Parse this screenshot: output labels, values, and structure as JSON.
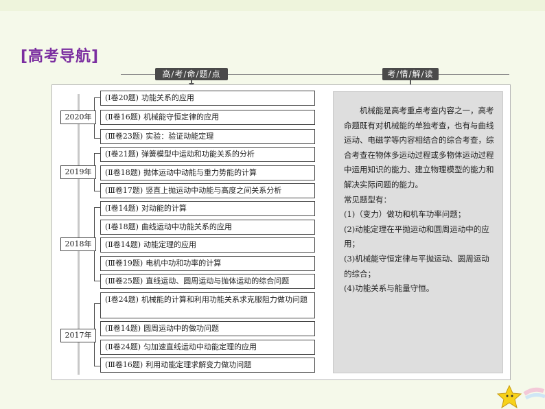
{
  "title": "[高考导航]",
  "headers": {
    "left": "高/考/命/题/点",
    "right": "考/情/解/读"
  },
  "groups": [
    {
      "year": "2020年",
      "items": [
        {
          "source": "(Ⅰ卷20题)",
          "text": "功能关系的应用"
        },
        {
          "source": "(Ⅱ卷16题)",
          "text": "机械能守恒定律的应用"
        },
        {
          "source": "(Ⅲ卷23题)",
          "text": "实验：验证动能定理"
        }
      ]
    },
    {
      "year": "2019年",
      "items": [
        {
          "source": "(Ⅰ卷21题)",
          "text": "弹簧模型中运动和功能关系的分析"
        },
        {
          "source": "(Ⅱ卷18题)",
          "text": "抛体运动中动能与重力势能的计算"
        },
        {
          "source": "(Ⅲ卷17题)",
          "text": "竖直上抛运动中动能与高度之间关系分析"
        }
      ]
    },
    {
      "year": "2018年",
      "items": [
        {
          "source": "(Ⅰ卷14题)",
          "text": "对动能的计算"
        },
        {
          "source": "(Ⅰ卷18题)",
          "text": "曲线运动中功能关系的应用"
        },
        {
          "source": "(Ⅱ卷14题)",
          "text": "动能定理的应用"
        },
        {
          "source": "(Ⅲ卷19题)",
          "text": "电机中功和功率的计算"
        },
        {
          "source": "(Ⅲ卷25题)",
          "text": "直线运动、圆周运动与抛体运动的综合问题"
        }
      ]
    },
    {
      "year": "2017年",
      "items": [
        {
          "source": "(Ⅰ卷24题)",
          "text": "机械能的计算和利用功能关系求克服阻力做功问题"
        },
        {
          "source": "(Ⅱ卷14题)",
          "text": "圆周运动中的做功问题"
        },
        {
          "source": "(Ⅱ卷24题)",
          "text": "匀加速直线运动中动能定理的应用"
        },
        {
          "source": "(Ⅲ卷16题)",
          "text": "利用动能定理求解变力做功问题"
        }
      ]
    }
  ],
  "analysis": {
    "intro": "机械能是高考重点考查内容之一，高考命题既有对机械能的单独考查，也有与曲线运动、电磁学等内容相结合的综合考查，综合考查在物体多运动过程或多物体运动过程中运用知识的能力、建立物理模型的能力和解决实际问题的能力。",
    "types_heading": "常见题型有：",
    "types": [
      "(1)（变力）做功和机车功率问题；",
      "(2)动能定理在平抛运动和圆周运动中的应用；",
      "(3)机械能守恒定律与平抛运动、圆周运动的综合；",
      "(4)功能关系与能量守恒。"
    ]
  },
  "colors": {
    "background": "#f5f9ea",
    "title": "#7b2ea0",
    "header_label_bg": "#4a4a4a",
    "panel_bg": "#dedede",
    "star": "#f7d21a"
  },
  "icons": [
    "star-icon"
  ]
}
